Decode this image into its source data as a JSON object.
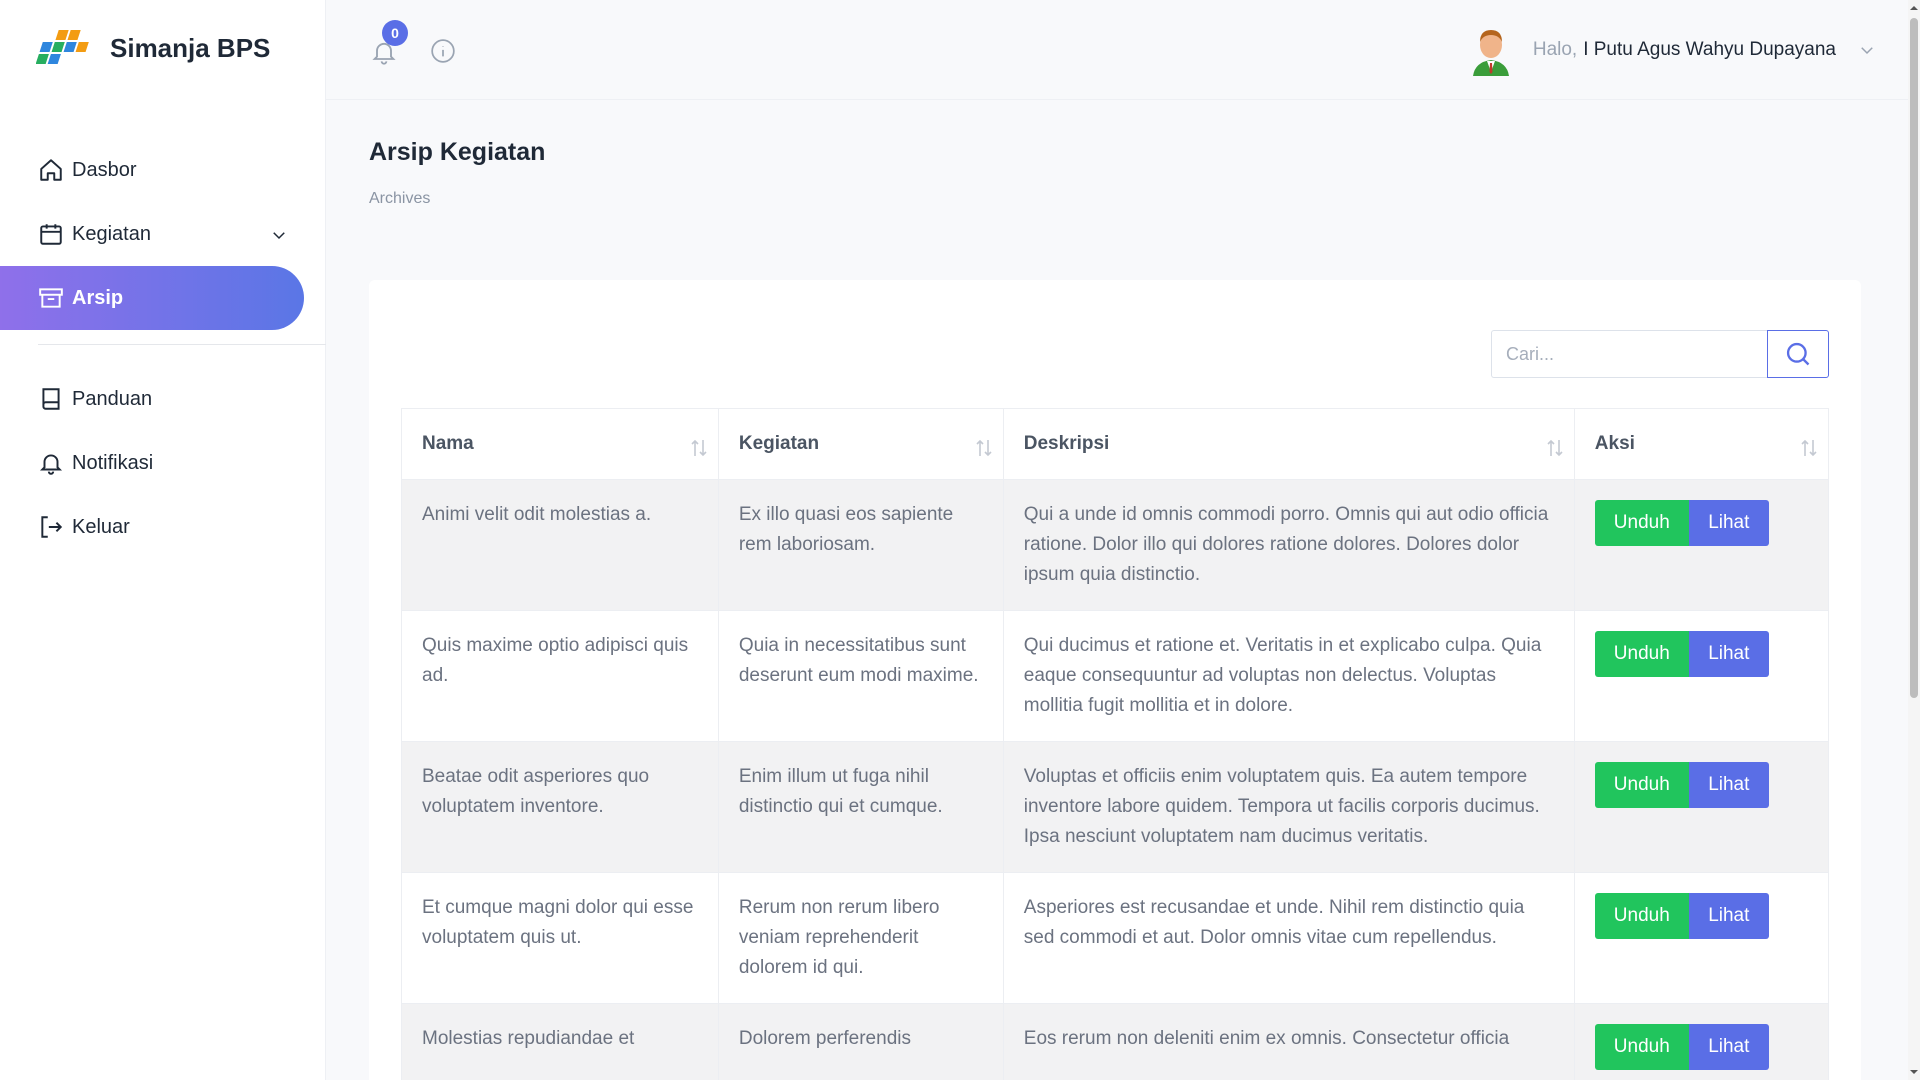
{
  "brand": {
    "name": "Simanja BPS"
  },
  "sidebar": {
    "items": [
      {
        "label": "Dasbor",
        "icon": "home-icon"
      },
      {
        "label": "Kegiatan",
        "icon": "calendar-icon"
      },
      {
        "label": "Arsip",
        "icon": "archive-icon",
        "active": true
      },
      {
        "label": "Panduan",
        "icon": "book-icon"
      },
      {
        "label": "Notifikasi",
        "icon": "bell-icon"
      },
      {
        "label": "Keluar",
        "icon": "logout-icon"
      }
    ]
  },
  "header": {
    "notification_count": "0",
    "greeting": "Halo,",
    "user_name": "I Putu Agus Wahyu Dupayana"
  },
  "main": {
    "title": "Arsip Kegiatan",
    "breadcrumb": "Archives",
    "search": {
      "placeholder": "Cari...",
      "value": ""
    }
  },
  "table": {
    "columns": [
      "Nama",
      "Kegiatan",
      "Deskripsi",
      "Aksi"
    ],
    "download_label": "Unduh",
    "view_label": "Lihat",
    "rows": [
      {
        "nama": "Animi velit odit molestias a.",
        "kegiatan": "Ex illo quasi eos sapiente rem laboriosam.",
        "deskripsi": "Qui a unde id omnis commodi porro. Omnis qui aut odio officia ratione. Dolor illo qui dolores ratione dolores. Dolores dolor ipsum quia distinctio."
      },
      {
        "nama": "Quis maxime optio adipisci quis ad.",
        "kegiatan": "Quia in necessitatibus sunt deserunt eum modi maxime.",
        "deskripsi": "Qui ducimus et ratione et. Veritatis in et explicabo culpa. Quia eaque consequuntur ad voluptas non delectus. Voluptas mollitia fugit mollitia et in dolore."
      },
      {
        "nama": "Beatae odit asperiores quo voluptatem inventore.",
        "kegiatan": "Enim illum ut fuga nihil distinctio qui et cumque.",
        "deskripsi": "Voluptas et officiis enim voluptatem quis. Ea autem tempore inventore labore quidem. Tempora ut facilis corporis ducimus. Ipsa nesciunt voluptatem nam ducimus veritatis."
      },
      {
        "nama": "Et cumque magni dolor qui esse voluptatem quis ut.",
        "kegiatan": "Rerum non rerum libero veniam reprehenderit dolorem id qui.",
        "deskripsi": "Asperiores est recusandae et unde. Nihil rem distinctio quia sed commodi et aut. Dolor omnis vitae cum repellendus."
      },
      {
        "nama": "Molestias repudiandae et",
        "kegiatan": "Dolorem perferendis",
        "deskripsi": "Eos rerum non deleniti enim ex omnis. Consectetur officia"
      }
    ]
  },
  "colors": {
    "accent": "#5a6ee6",
    "accent_gradient_start": "#8f70ea",
    "download_button": "#21c55d",
    "view_button": "#5a6ee6"
  }
}
